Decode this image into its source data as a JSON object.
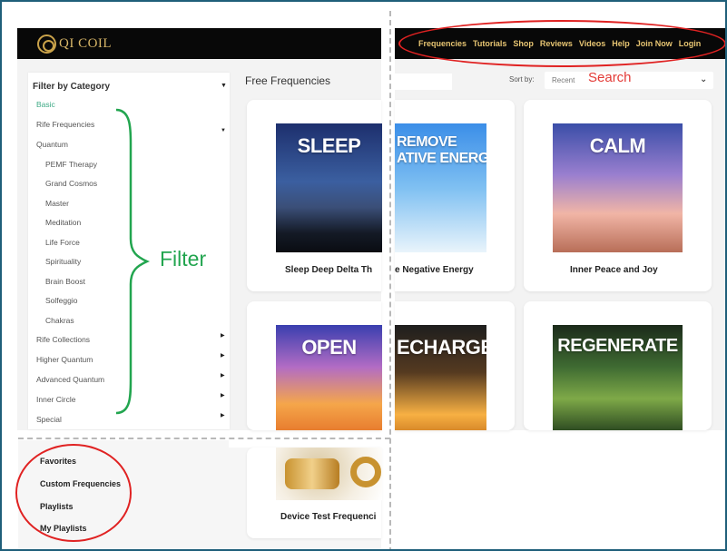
{
  "brand": {
    "name": "QI COIL"
  },
  "nav": {
    "items": [
      "Frequencies",
      "Tutorials",
      "Shop",
      "Reviews",
      "Videos",
      "Help",
      "Join Now",
      "Login"
    ]
  },
  "annotations": {
    "search": "Search",
    "filter": "Filter"
  },
  "sidebar": {
    "title": "Filter by Category",
    "categories": [
      {
        "label": "Basic"
      },
      {
        "label": "Rife Frequencies"
      },
      {
        "label": "Quantum"
      },
      {
        "label": "PEMF Therapy"
      },
      {
        "label": "Grand Cosmos"
      },
      {
        "label": "Master"
      },
      {
        "label": "Meditation"
      },
      {
        "label": "Life Force"
      },
      {
        "label": "Spirituality"
      },
      {
        "label": "Brain Boost"
      },
      {
        "label": "Solfeggio"
      },
      {
        "label": "Chakras"
      },
      {
        "label": "Rife Collections"
      },
      {
        "label": "Higher Quantum"
      },
      {
        "label": "Advanced Quantum"
      },
      {
        "label": "Inner Circle"
      },
      {
        "label": "Special"
      }
    ]
  },
  "main": {
    "title": "Free Frequencies",
    "search": {
      "value": "",
      "placeholder": ""
    },
    "sort": {
      "label": "Sort by:",
      "value": "Recent"
    },
    "cards": [
      {
        "image_word": "SLEEP",
        "title": "Sleep Deep Delta Th"
      },
      {
        "image_word": "REMOVE\nATIVE ENERGY",
        "title": "e Negative Energy"
      },
      {
        "image_word": "CALM",
        "title": "Inner Peace and Joy"
      },
      {
        "image_word": "OPEN",
        "title": ""
      },
      {
        "image_word": "ECHARGE",
        "title": ""
      },
      {
        "image_word": "REGENERATE",
        "title": ""
      },
      {
        "image_word": "",
        "title": "Device Test Frequenci"
      }
    ]
  },
  "library": {
    "items": [
      "Favorites",
      "Custom Frequencies",
      "Playlists",
      "My Playlists"
    ]
  },
  "colors": {
    "accent_green": "#3faa86",
    "annotation_red": "#e02222",
    "annotation_green": "#22a54f",
    "nav_gold": "#e7c572"
  }
}
